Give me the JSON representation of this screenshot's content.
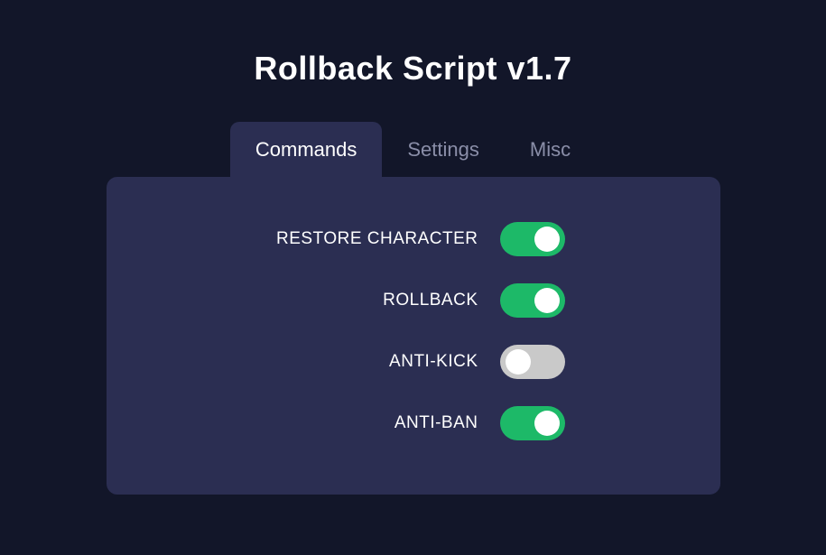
{
  "header": {
    "title": "Rollback Script v1.7"
  },
  "tabs": {
    "commands": "Commands",
    "settings": "Settings",
    "misc": "Misc",
    "active": "commands"
  },
  "commands": {
    "items": [
      {
        "label": "RESTORE CHARACTER",
        "enabled": true
      },
      {
        "label": "ROLLBACK",
        "enabled": true
      },
      {
        "label": "ANTI-KICK",
        "enabled": false
      },
      {
        "label": "ANTI-BAN",
        "enabled": true
      }
    ]
  },
  "colors": {
    "background": "#121629",
    "panel": "#2b2e52",
    "toggleOn": "#1db968",
    "toggleOff": "#c9c9c9",
    "textPrimary": "#ffffff",
    "textMuted": "#8a8ea8"
  }
}
